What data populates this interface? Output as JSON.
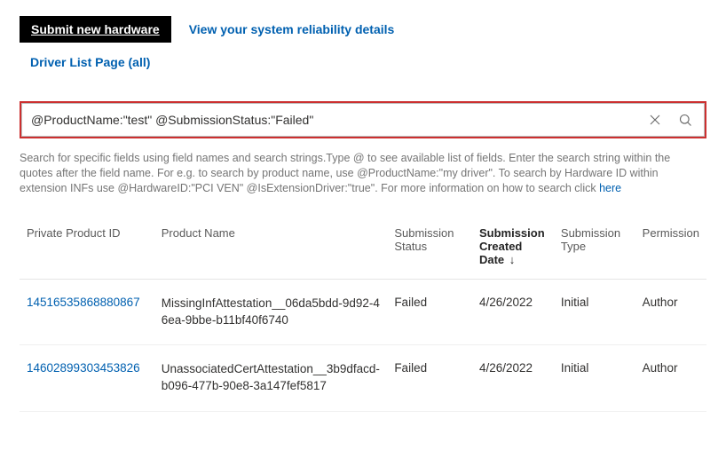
{
  "actions": {
    "submit_hardware": "Submit new hardware",
    "reliability": "View your system reliability details",
    "driver_list": "Driver List Page (all)"
  },
  "search": {
    "value": "@ProductName:\"test\" @SubmissionStatus:\"Failed\""
  },
  "help": {
    "text": "Search for specific fields using field names and search strings.Type @ to see available list of fields. Enter the search string within the quotes after the field name. For e.g. to search by product name, use @ProductName:\"my driver\". To search by Hardware ID within extension INFs use @HardwareID:\"PCI VEN\" @IsExtensionDriver:\"true\". For more information on how to search click ",
    "link": "here"
  },
  "table": {
    "headers": {
      "id": "Private Product ID",
      "name": "Product Name",
      "status": "Submission Status",
      "date": "Submission Created Date",
      "type": "Submission Type",
      "permission": "Permission"
    },
    "sort_indicator": "↓",
    "rows": [
      {
        "id": "14516535868880867",
        "name": "MissingInfAttestation__06da5bdd-9d92-46ea-9bbe-b11bf40f6740",
        "status": "Failed",
        "date": "4/26/2022",
        "type": "Initial",
        "permission": "Author"
      },
      {
        "id": "14602899303453826",
        "name": "UnassociatedCertAttestation__3b9dfacd-b096-477b-90e8-3a147fef5817",
        "status": "Failed",
        "date": "4/26/2022",
        "type": "Initial",
        "permission": "Author"
      }
    ]
  }
}
